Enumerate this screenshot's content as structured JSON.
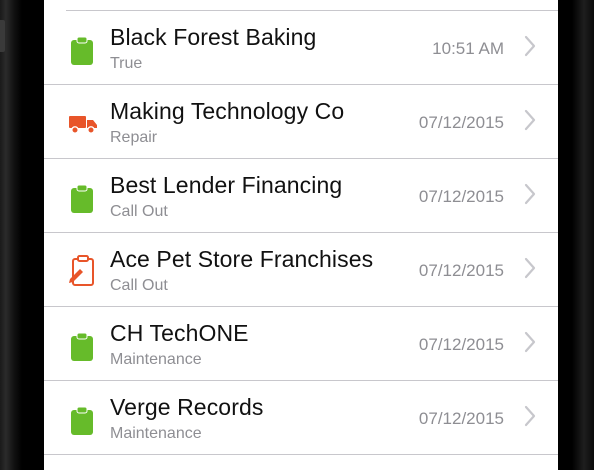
{
  "colors": {
    "green": "#66bb2a",
    "orange": "#e8552a",
    "text": "#111111",
    "secondary": "#8e8e93",
    "separator": "#c8c7cc"
  },
  "list": {
    "items": [
      {
        "title": "Black Forest Baking",
        "subtitle": "True",
        "date": "10:51 AM",
        "icon": "clipboard-icon",
        "icon_color": "#66bb2a"
      },
      {
        "title": "Making Technology Co",
        "subtitle": "Repair",
        "date": "07/12/2015",
        "icon": "truck-icon",
        "icon_color": "#e8552a"
      },
      {
        "title": "Best Lender Financing",
        "subtitle": "Call Out",
        "date": "07/12/2015",
        "icon": "clipboard-icon",
        "icon_color": "#66bb2a"
      },
      {
        "title": "Ace Pet Store Franchises",
        "subtitle": "Call Out",
        "date": "07/12/2015",
        "icon": "clipboard-edit-icon",
        "icon_color": "#e8552a"
      },
      {
        "title": "CH TechONE",
        "subtitle": "Maintenance",
        "date": "07/12/2015",
        "icon": "clipboard-icon",
        "icon_color": "#66bb2a"
      },
      {
        "title": "Verge Records",
        "subtitle": "Maintenance",
        "date": "07/12/2015",
        "icon": "clipboard-icon",
        "icon_color": "#66bb2a"
      }
    ]
  }
}
